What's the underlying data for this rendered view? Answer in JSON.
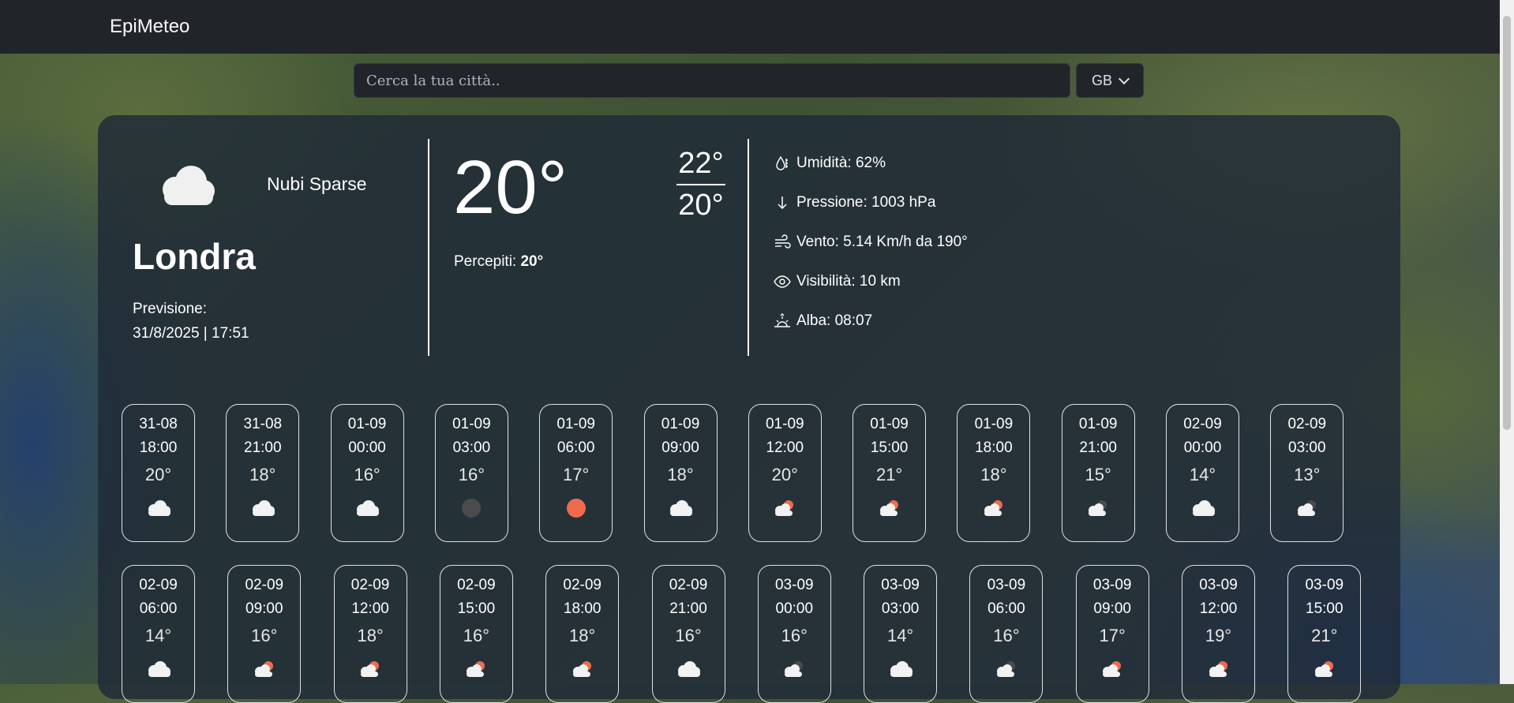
{
  "navbar": {
    "brand": "EpiMeteo"
  },
  "search": {
    "placeholder": "Cerca la tua città..",
    "country": "GB"
  },
  "current": {
    "condition": "Nubi Sparse",
    "city": "Londra",
    "forecast_label": "Previsione:",
    "forecast_datetime": "31/8/2025 | 17:51",
    "temp": "20°",
    "perceived_label": "Percepiti:",
    "perceived_value": "20°",
    "max": "22°",
    "min": "20°",
    "humidity": "Umidità: 62%",
    "pressure": "Pressione: 1003 hPa",
    "wind": "Vento: 5.14 Km/h da 190°",
    "visibility": "Visibilità: 10 km",
    "sunrise": "Alba: 08:07"
  },
  "hourly_row1": [
    {
      "date": "31-08",
      "time": "18:00",
      "temp": "20°",
      "icon": "cloud-icon"
    },
    {
      "date": "31-08",
      "time": "21:00",
      "temp": "18°",
      "icon": "cloud-icon"
    },
    {
      "date": "01-09",
      "time": "00:00",
      "temp": "16°",
      "icon": "cloud-icon"
    },
    {
      "date": "01-09",
      "time": "03:00",
      "temp": "16°",
      "icon": "moon-icon"
    },
    {
      "date": "01-09",
      "time": "06:00",
      "temp": "17°",
      "icon": "sun-icon"
    },
    {
      "date": "01-09",
      "time": "09:00",
      "temp": "18°",
      "icon": "cloud-icon"
    },
    {
      "date": "01-09",
      "time": "12:00",
      "temp": "20°",
      "icon": "sun-cloud-icon"
    },
    {
      "date": "01-09",
      "time": "15:00",
      "temp": "21°",
      "icon": "sun-cloud-icon"
    },
    {
      "date": "01-09",
      "time": "18:00",
      "temp": "18°",
      "icon": "sun-cloud-icon"
    },
    {
      "date": "01-09",
      "time": "21:00",
      "temp": "15°",
      "icon": "moon-cloud-icon"
    },
    {
      "date": "02-09",
      "time": "00:00",
      "temp": "14°",
      "icon": "cloud-icon"
    },
    {
      "date": "02-09",
      "time": "03:00",
      "temp": "13°",
      "icon": "moon-cloud-icon"
    }
  ],
  "hourly_row2": [
    {
      "date": "02-09",
      "time": "06:00",
      "temp": "14°",
      "icon": "cloud-icon"
    },
    {
      "date": "02-09",
      "time": "09:00",
      "temp": "16°",
      "icon": "sun-cloud-icon"
    },
    {
      "date": "02-09",
      "time": "12:00",
      "temp": "18°",
      "icon": "sun-cloud-icon"
    },
    {
      "date": "02-09",
      "time": "15:00",
      "temp": "16°",
      "icon": "sun-cloud-icon"
    },
    {
      "date": "02-09",
      "time": "18:00",
      "temp": "18°",
      "icon": "sun-cloud-icon"
    },
    {
      "date": "02-09",
      "time": "21:00",
      "temp": "16°",
      "icon": "cloud-icon"
    },
    {
      "date": "03-09",
      "time": "00:00",
      "temp": "16°",
      "icon": "moon-cloud-icon"
    },
    {
      "date": "03-09",
      "time": "03:00",
      "temp": "14°",
      "icon": "cloud-icon"
    },
    {
      "date": "03-09",
      "time": "06:00",
      "temp": "16°",
      "icon": "moon-cloud-icon"
    },
    {
      "date": "03-09",
      "time": "09:00",
      "temp": "17°",
      "icon": "sun-cloud-icon"
    },
    {
      "date": "03-09",
      "time": "12:00",
      "temp": "19°",
      "icon": "sun-cloud-icon"
    },
    {
      "date": "03-09",
      "time": "15:00",
      "temp": "21°",
      "icon": "sun-cloud-icon"
    }
  ]
}
